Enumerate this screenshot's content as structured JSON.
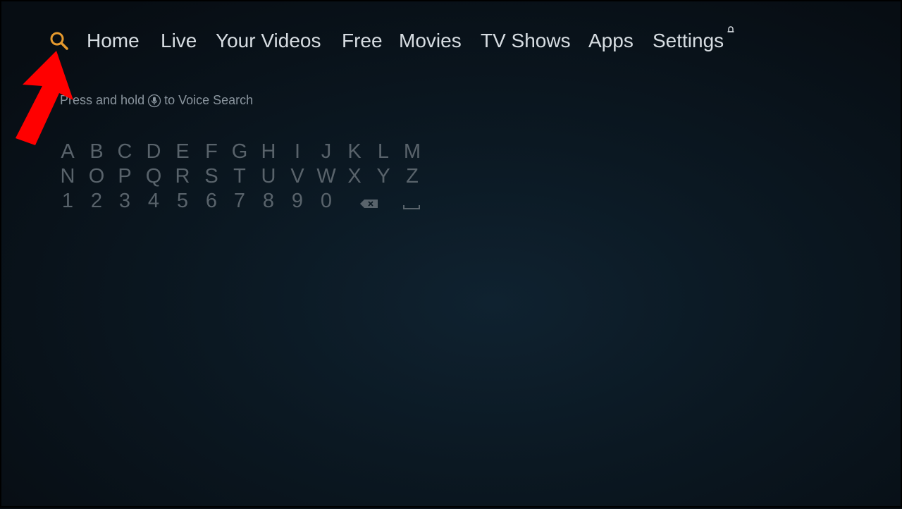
{
  "nav": {
    "search_icon": "search-icon",
    "items": [
      {
        "label": "Home"
      },
      {
        "label": "Live"
      },
      {
        "label": "Your Videos"
      },
      {
        "label": "Free"
      },
      {
        "label": "Movies"
      },
      {
        "label": "TV Shows"
      },
      {
        "label": "Apps"
      },
      {
        "label": "Settings"
      }
    ],
    "notification_icon": "bell-icon"
  },
  "search": {
    "voice_hint_prefix": "Press and hold",
    "voice_hint_suffix": "to Voice Search",
    "keyboard": {
      "row1": [
        "A",
        "B",
        "C",
        "D",
        "E",
        "F",
        "G",
        "H",
        "I",
        "J",
        "K",
        "L",
        "M"
      ],
      "row2": [
        "N",
        "O",
        "P",
        "Q",
        "R",
        "S",
        "T",
        "U",
        "V",
        "W",
        "X",
        "Y",
        "Z"
      ],
      "row3": [
        "1",
        "2",
        "3",
        "4",
        "5",
        "6",
        "7",
        "8",
        "9",
        "0"
      ],
      "special_keys": [
        "backspace-icon",
        "space-icon"
      ]
    }
  },
  "annotation": {
    "arrow_color": "#ff0000"
  },
  "colors": {
    "accent": "#e69a2e",
    "nav_text": "#d7dde2",
    "hint_text": "#8a959e",
    "key_text": "#59636b"
  }
}
